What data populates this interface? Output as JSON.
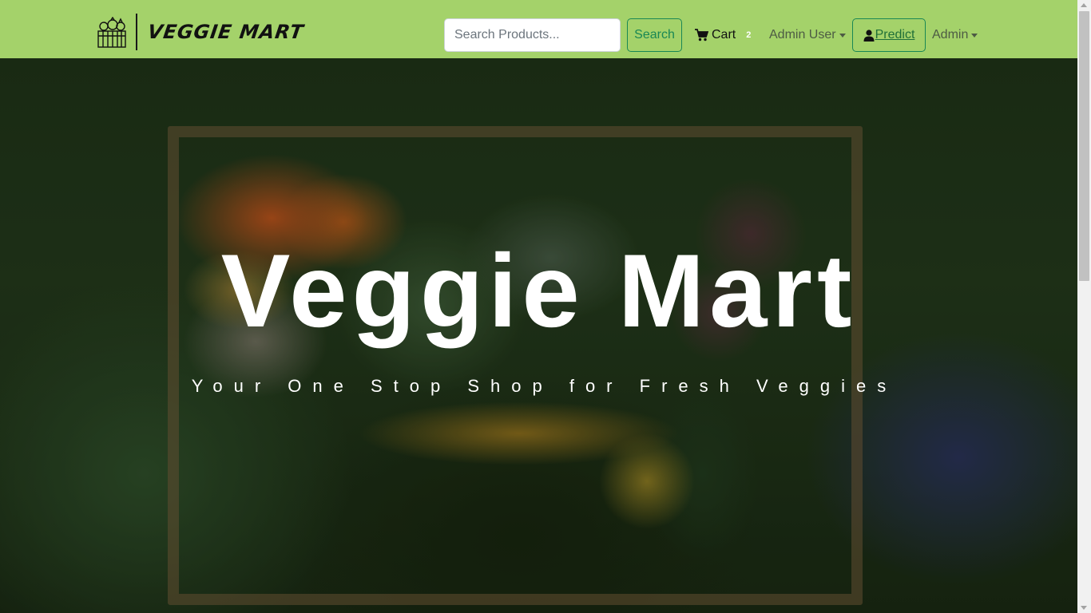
{
  "navbar": {
    "brand_name": "VEGGIE MART",
    "brand_icon": "vegetable-basket-icon",
    "background_color": "#a4d26a",
    "search": {
      "placeholder": "Search Products...",
      "value": ""
    },
    "search_button_label": "Search",
    "cart": {
      "label": "Cart",
      "count": "2",
      "icon": "cart-icon"
    },
    "user_menu_label": "Admin User",
    "predict": {
      "label": "Predict",
      "icon": "user-icon"
    },
    "admin_menu_label": "Admin",
    "accent_color": "#198754"
  },
  "hero": {
    "title": "Veggie Mart",
    "subtitle": "Your One Stop Shop for Fresh Veggies"
  }
}
